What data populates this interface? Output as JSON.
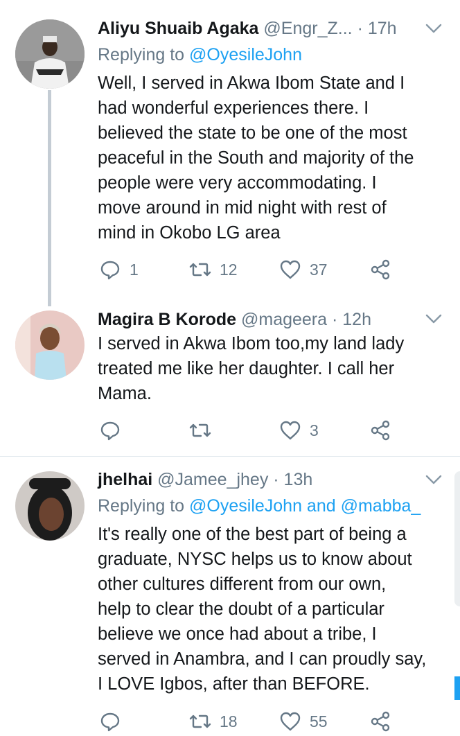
{
  "tweets": [
    {
      "name": "Aliyu Shuaib Agaka",
      "handle": "@Engr_Z...",
      "time": "· 17h",
      "replying_prefix": "Replying to ",
      "replying_to": "@OyesileJohn",
      "lines": [
        "Well, I served in Akwa Ibom State and I",
        "had wonderful experiences there. I",
        "believed the state to be one of the most",
        "peaceful in the South and majority of the",
        "people were very accommodating. I",
        "move around in mid night with rest of",
        "mind in Okobo LG area"
      ],
      "replies": "1",
      "retweets": "12",
      "likes": "37"
    },
    {
      "name": "Magira B Korode",
      "handle": "@mageera",
      "time": "· 12h",
      "lines": [
        "I served in Akwa Ibom too,my land lady",
        "treated me like her daughter. I call her",
        "Mama."
      ],
      "replies": "",
      "retweets": "",
      "likes": "3"
    },
    {
      "name": "jhelhai",
      "handle": "@Jamee_jhey",
      "time": "· 13h",
      "replying_prefix": "Replying to ",
      "replying_to": "@OyesileJohn and @mabba_",
      "lines": [
        "It's really one of the best part of being a",
        "graduate, NYSC helps us to know about",
        "other cultures different from our own,",
        "help to clear the doubt of a particular",
        "believe we once had about a tribe, I",
        "served in Anambra, and I can proudly say,",
        "I LOVE Igbos, after than BEFORE."
      ],
      "replies": "",
      "retweets": "18",
      "likes": "55"
    }
  ],
  "icons": {
    "reply": "reply-icon",
    "retweet": "retweet-icon",
    "like": "heart-icon",
    "share": "share-icon",
    "more": "chevron-down-icon"
  },
  "colors": {
    "link": "#1da1f2",
    "muted": "#657786",
    "text": "#14171a",
    "thread_line": "#c4ccd4"
  }
}
